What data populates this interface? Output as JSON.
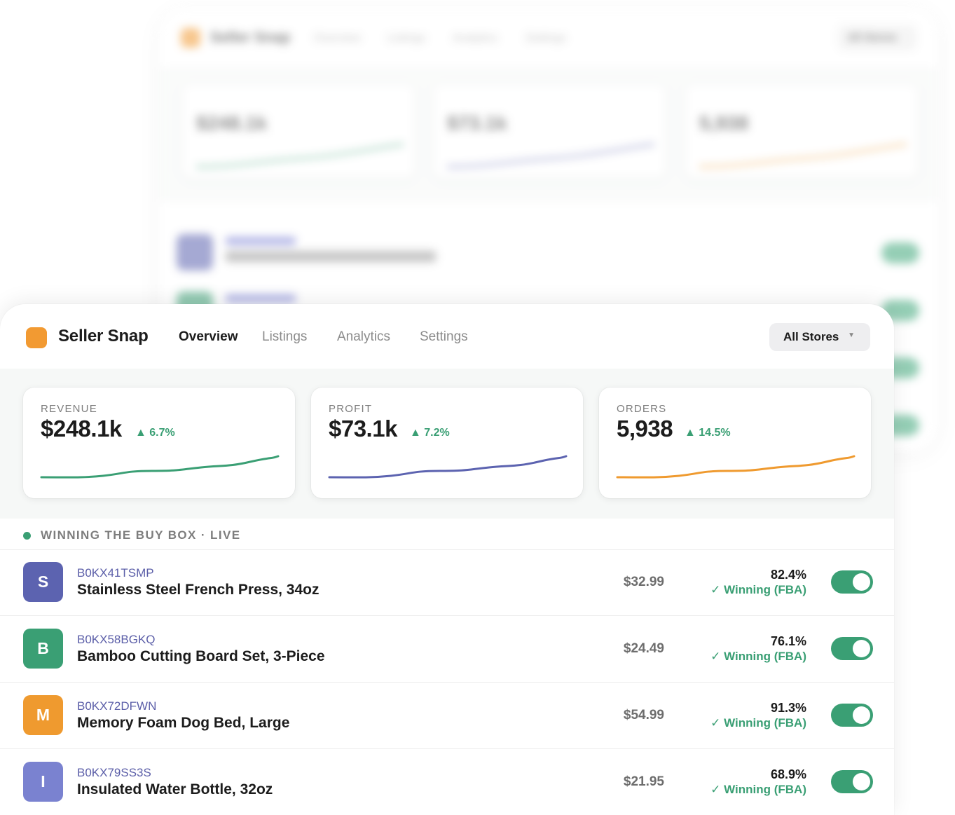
{
  "app": {
    "brand": "Seller Snap",
    "nav": [
      "Overview",
      "Listings",
      "Analytics",
      "Settings"
    ],
    "active_nav": "Overview",
    "store_select": {
      "value": "All Stores"
    }
  },
  "metrics": [
    {
      "label": "REVENUE",
      "value": "$248.1k",
      "delta": "▲ 6.7%",
      "color": "#3a9f74"
    },
    {
      "label": "PROFIT",
      "value": "$73.1k",
      "delta": "▲ 7.2%",
      "color": "#5c63b0"
    },
    {
      "label": "ORDERS",
      "value": "5,938",
      "delta": "▲ 14.5%",
      "color": "#ef9a2f"
    }
  ],
  "section": {
    "title": "WINNING THE BUY BOX · LIVE"
  },
  "listings": [
    {
      "initial": "S",
      "sku": "B0KX41TSMP",
      "name": "Stainless Steel French Press, 34oz",
      "price": "$32.99",
      "buybox_pct": "82.4%",
      "status": "✓ Winning (FBA)",
      "enabled": true,
      "avatar_color": "#5c63b0"
    },
    {
      "initial": "B",
      "sku": "B0KX58BGKQ",
      "name": "Bamboo Cutting Board Set, 3-Piece",
      "price": "$24.49",
      "buybox_pct": "76.1%",
      "status": "✓ Winning (FBA)",
      "enabled": true,
      "avatar_color": "#3a9f74"
    },
    {
      "initial": "M",
      "sku": "B0KX72DFWN",
      "name": "Memory Foam Dog Bed, Large",
      "price": "$54.99",
      "buybox_pct": "91.3%",
      "status": "✓ Winning (FBA)",
      "enabled": true,
      "avatar_color": "#ef9a2f"
    },
    {
      "initial": "I",
      "sku": "B0KX79SS3S",
      "name": "Insulated Water Bottle, 32oz",
      "price": "$21.95",
      "buybox_pct": "68.9%",
      "status": "✓ Winning (FBA)",
      "enabled": true,
      "avatar_color": "#7a82d0"
    }
  ],
  "background_card": {
    "brand": "Seller Snap",
    "store_select": "All Stores",
    "metrics": [
      "$248.1k",
      "$73.1k",
      "5,938"
    ],
    "first_item": "Stainless Steel French Press, 34oz"
  }
}
